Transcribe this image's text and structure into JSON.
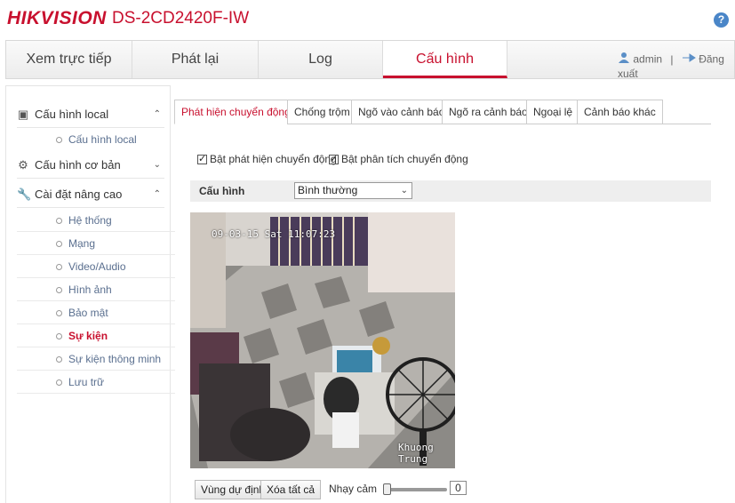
{
  "header": {
    "brand": "HIKVISION",
    "model": "DS-2CD2420F-IW",
    "help_symbol": "?"
  },
  "nav": {
    "items": [
      {
        "label": "Xem trực tiếp"
      },
      {
        "label": "Phát lại"
      },
      {
        "label": "Log"
      },
      {
        "label": "Cấu hình"
      }
    ],
    "active": "Cấu hình",
    "user": "admin",
    "separator": "|",
    "logout": "Đăng xuất"
  },
  "sidebar": {
    "local": {
      "label": "Cấu hình local",
      "sub": [
        "Cấu hình local"
      ]
    },
    "basic": {
      "label": "Cấu hình cơ bản"
    },
    "advanced": {
      "label": "Cài đặt nâng cao",
      "sub": [
        "Hệ thống",
        "Mạng",
        "Video/Audio",
        "Hình ảnh",
        "Bảo mật",
        "Sự kiện",
        "Sự kiện thông minh",
        "Lưu trữ"
      ]
    },
    "active_sub": "Sự kiện"
  },
  "tabs": [
    "Phát hiện chuyển động",
    "Chống trộm",
    "Ngõ vào cảnh báo",
    "Ngõ ra cảnh báo",
    "Ngoại lệ",
    "Cảnh báo khác"
  ],
  "active_tab": "Phát hiện chuyển động",
  "form": {
    "enable_motion": "Bật phát hiện chuyển động",
    "enable_analysis": "Bật phân tích chuyển động",
    "config_label": "Cấu hình",
    "config_value": "Bình thường"
  },
  "video": {
    "osd_timestamp": "09-03-15 Sat 11:07:23",
    "osd_channel": "Khuong Trung"
  },
  "controls": {
    "draw_area": "Vùng dự định",
    "clear_all": "Xóa tất cả",
    "sensitivity_label": "Nhạy cảm",
    "sensitivity_value": "0"
  }
}
